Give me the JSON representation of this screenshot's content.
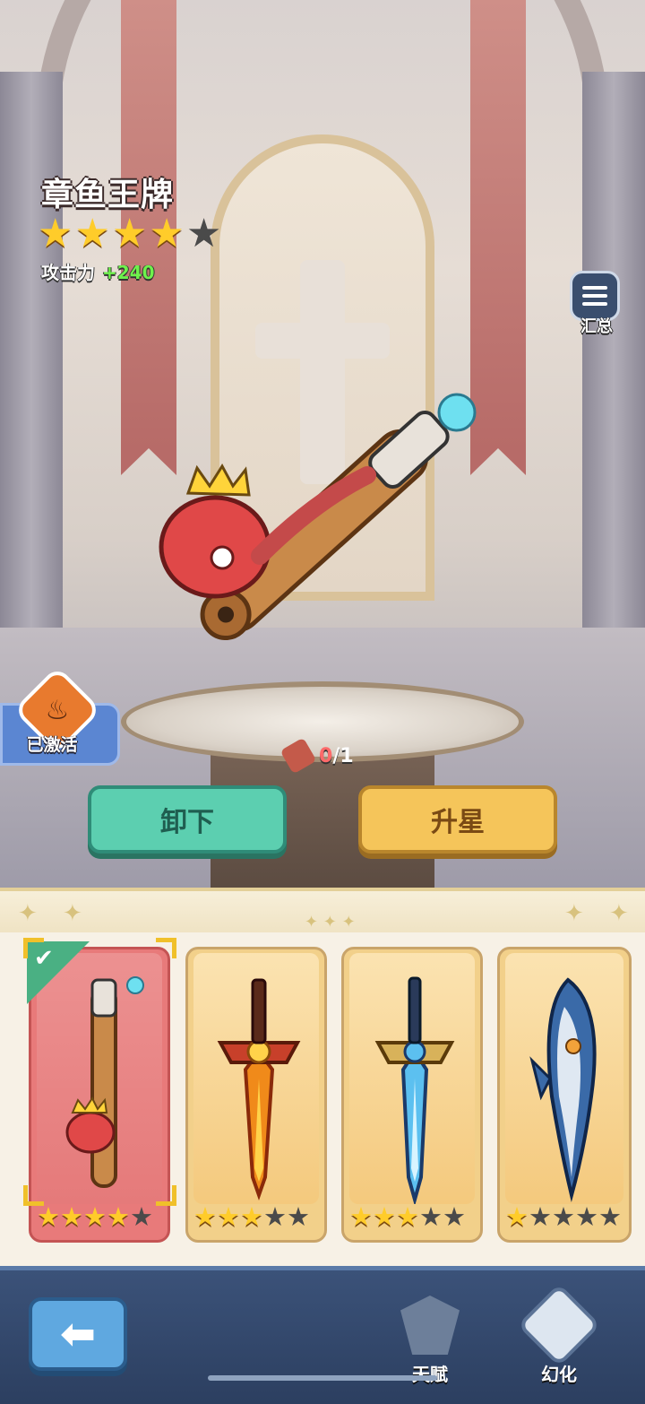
{
  "weapon": {
    "name": "章鱼王牌",
    "stars_filled": 4,
    "stars_total": 5,
    "attack_label": "攻击力",
    "attack_value": "+240"
  },
  "summary_button": {
    "label": "汇总"
  },
  "activated_badge": {
    "label": "已激活"
  },
  "fragments": {
    "current": "0",
    "required": "/1"
  },
  "actions": {
    "unequip_label": "卸下",
    "upgrade_label": "升星"
  },
  "collection": [
    {
      "id": "octopus-bat",
      "stars_filled": 4,
      "stars_total": 5,
      "selected": true
    },
    {
      "id": "flame-sword",
      "stars_filled": 3,
      "stars_total": 5,
      "selected": false
    },
    {
      "id": "ice-sword",
      "stars_filled": 3,
      "stars_total": 5,
      "selected": false
    },
    {
      "id": "swordfish",
      "stars_filled": 1,
      "stars_total": 5,
      "selected": false
    }
  ],
  "nav": {
    "talent_label": "天赋",
    "illusion_label": "幻化"
  },
  "icons": {
    "back": "left-arrow-icon",
    "summary": "menu-lines-icon",
    "talent": "winged-shield-icon",
    "illusion": "panda-emblem-icon"
  }
}
